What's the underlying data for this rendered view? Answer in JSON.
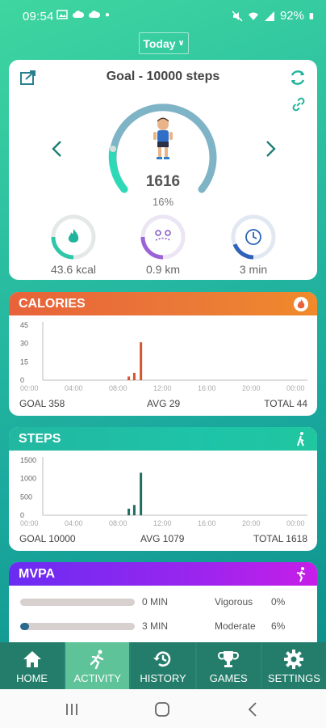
{
  "status_bar": {
    "time": "09:54",
    "battery": "92%"
  },
  "period": {
    "label": "Today",
    "chevron": "∨"
  },
  "goal_card": {
    "title": "Goal - 10000 steps",
    "steps": "1616",
    "progress_pct_text": "16%",
    "progress_fraction": 0.16,
    "stats": [
      {
        "icon": "flame-icon",
        "value": "43.6 kcal",
        "color": "#2ec7a8",
        "fraction": 0.25
      },
      {
        "icon": "map-route-icon",
        "value": "0.9 km",
        "color": "#9a63d6",
        "fraction": 0.25
      },
      {
        "icon": "clock-icon",
        "value": "3 min",
        "color": "#2d63b8",
        "fraction": 0.2
      }
    ]
  },
  "calories": {
    "title": "CALORIES",
    "footer": {
      "goal": "GOAL  358",
      "avg": "AVG  29",
      "total": "TOTAL  44"
    }
  },
  "steps_card": {
    "title": "STEPS",
    "footer": {
      "goal": "GOAL  10000",
      "avg": "AVG  1079",
      "total": "TOTAL  1618"
    }
  },
  "mvpa": {
    "title": "MVPA",
    "rows": [
      {
        "minutes": "0 MIN",
        "label": "Vigorous",
        "pct": "0%",
        "fraction": 0.0
      },
      {
        "minutes": "3 MIN",
        "label": "Moderate",
        "pct": "6%",
        "fraction": 0.06
      }
    ]
  },
  "bottom_nav": [
    {
      "label": "HOME",
      "icon": "home-icon",
      "active": false
    },
    {
      "label": "ACTIVITY",
      "icon": "running-person-icon",
      "active": true
    },
    {
      "label": "HISTORY",
      "icon": "history-icon",
      "active": false
    },
    {
      "label": "GAMES",
      "icon": "trophy-icon",
      "active": false
    },
    {
      "label": "SETTINGS",
      "icon": "gear-icon",
      "active": false
    }
  ],
  "chart_data": [
    {
      "type": "bar",
      "title": "CALORIES",
      "x": [
        "00:00",
        "04:00",
        "08:00",
        "12:00",
        "16:00",
        "20:00",
        "00:00"
      ],
      "yticks": [
        "45",
        "30",
        "15",
        "0"
      ],
      "ylim": [
        0,
        45
      ],
      "color": "#d9532e",
      "bars": [
        {
          "hour": 7.8,
          "value": 3
        },
        {
          "hour": 8.3,
          "value": 6
        },
        {
          "hour": 8.9,
          "value": 31
        }
      ]
    },
    {
      "type": "bar",
      "title": "STEPS",
      "x": [
        "00:00",
        "04:00",
        "08:00",
        "12:00",
        "16:00",
        "20:00",
        "00:00"
      ],
      "yticks": [
        "1500",
        "1000",
        "500",
        "0"
      ],
      "ylim": [
        0,
        1500
      ],
      "color": "#1f6e5f",
      "bars": [
        {
          "hour": 7.8,
          "value": 180
        },
        {
          "hour": 8.3,
          "value": 280
        },
        {
          "hour": 8.9,
          "value": 1160
        }
      ]
    }
  ]
}
